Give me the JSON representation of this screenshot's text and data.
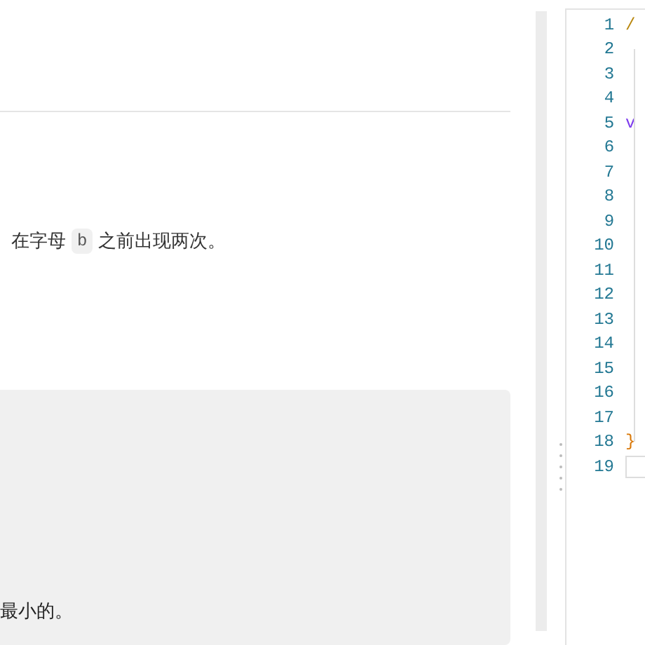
{
  "description": [
    {
      "kind": "text",
      "text": "在字母"
    },
    {
      "kind": "code",
      "text": "b"
    },
    {
      "kind": "text",
      "text": "之前出现两次。"
    }
  ],
  "example_block": {
    "text": "最小的。"
  },
  "editor": {
    "lines": [
      {
        "number": "1",
        "code": "/",
        "kind": "comment"
      },
      {
        "number": "2",
        "kind": "plain"
      },
      {
        "number": "3",
        "kind": "plain"
      },
      {
        "number": "4",
        "kind": "plain"
      },
      {
        "number": "5",
        "code": "v",
        "kind": "keyword"
      },
      {
        "number": "6",
        "kind": "plain"
      },
      {
        "number": "7",
        "kind": "plain"
      },
      {
        "number": "8",
        "kind": "plain"
      },
      {
        "number": "9",
        "kind": "plain"
      },
      {
        "number": "10",
        "kind": "plain"
      },
      {
        "number": "11",
        "kind": "plain"
      },
      {
        "number": "12",
        "kind": "plain"
      },
      {
        "number": "13",
        "kind": "plain"
      },
      {
        "number": "14",
        "kind": "plain"
      },
      {
        "number": "15",
        "kind": "plain"
      },
      {
        "number": "16",
        "kind": "plain"
      },
      {
        "number": "17",
        "kind": "plain"
      },
      {
        "number": "18",
        "code": "}",
        "kind": "bracket"
      },
      {
        "number": "19",
        "kind": "cursor"
      }
    ]
  }
}
